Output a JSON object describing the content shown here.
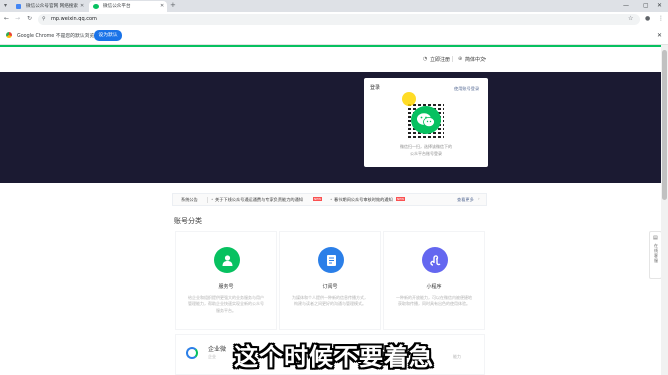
{
  "browser": {
    "tabs": [
      {
        "label": "微信公众号官网 网络搜索",
        "active": false
      },
      {
        "label": "微信公众平台",
        "active": true
      }
    ],
    "url": "mp.weixin.qq.com",
    "infobar": {
      "message": "Google Chrome 不是您的默认浏览器",
      "button_label": "设为默认"
    }
  },
  "header": {
    "register_label": "立即注册",
    "language_label": "简体中文"
  },
  "login": {
    "title": "登录",
    "switch_label": "使用账号登录",
    "hint_line1": "微信扫一扫，选择该微信下的",
    "hint_line2": "公众平台账号登录"
  },
  "notice": {
    "label": "系统公告",
    "items": [
      {
        "text": "关于下线公众号通运通费与专家负责能力的通知",
        "badge": "NEW"
      },
      {
        "text": "春节期间公众号审核时效的通知",
        "badge": "NEW"
      }
    ],
    "more_label": "查看更多"
  },
  "section_title": "账号分类",
  "cards": [
    {
      "title": "服务号",
      "desc": "给企业和组织提供更强大的业务服务与用户管理能力，帮助企业快速实现全新的公众号服务平台。",
      "color": "#07c160"
    },
    {
      "title": "订阅号",
      "desc": "为媒体和个人提供一种新的信息传播方式，构建与读者之间更好的沟通与管理模式。",
      "color": "#2b7fe8"
    },
    {
      "title": "小程序",
      "desc": "一种新的开放能力，可以在微信内被便捷地获取和传播，同时具有出色的使用体验。",
      "color": "#6467f0"
    }
  ],
  "enterprise": {
    "title": "企业微",
    "desc_prefix": "企业",
    "desc_suffix": "能力"
  },
  "float_tab_label": "在线客服",
  "subtitle": "这个时候不要着急",
  "colors": {
    "brand_green": "#07c160",
    "banner_bg": "#1b1a32",
    "chrome_button": "#1a73e8"
  }
}
